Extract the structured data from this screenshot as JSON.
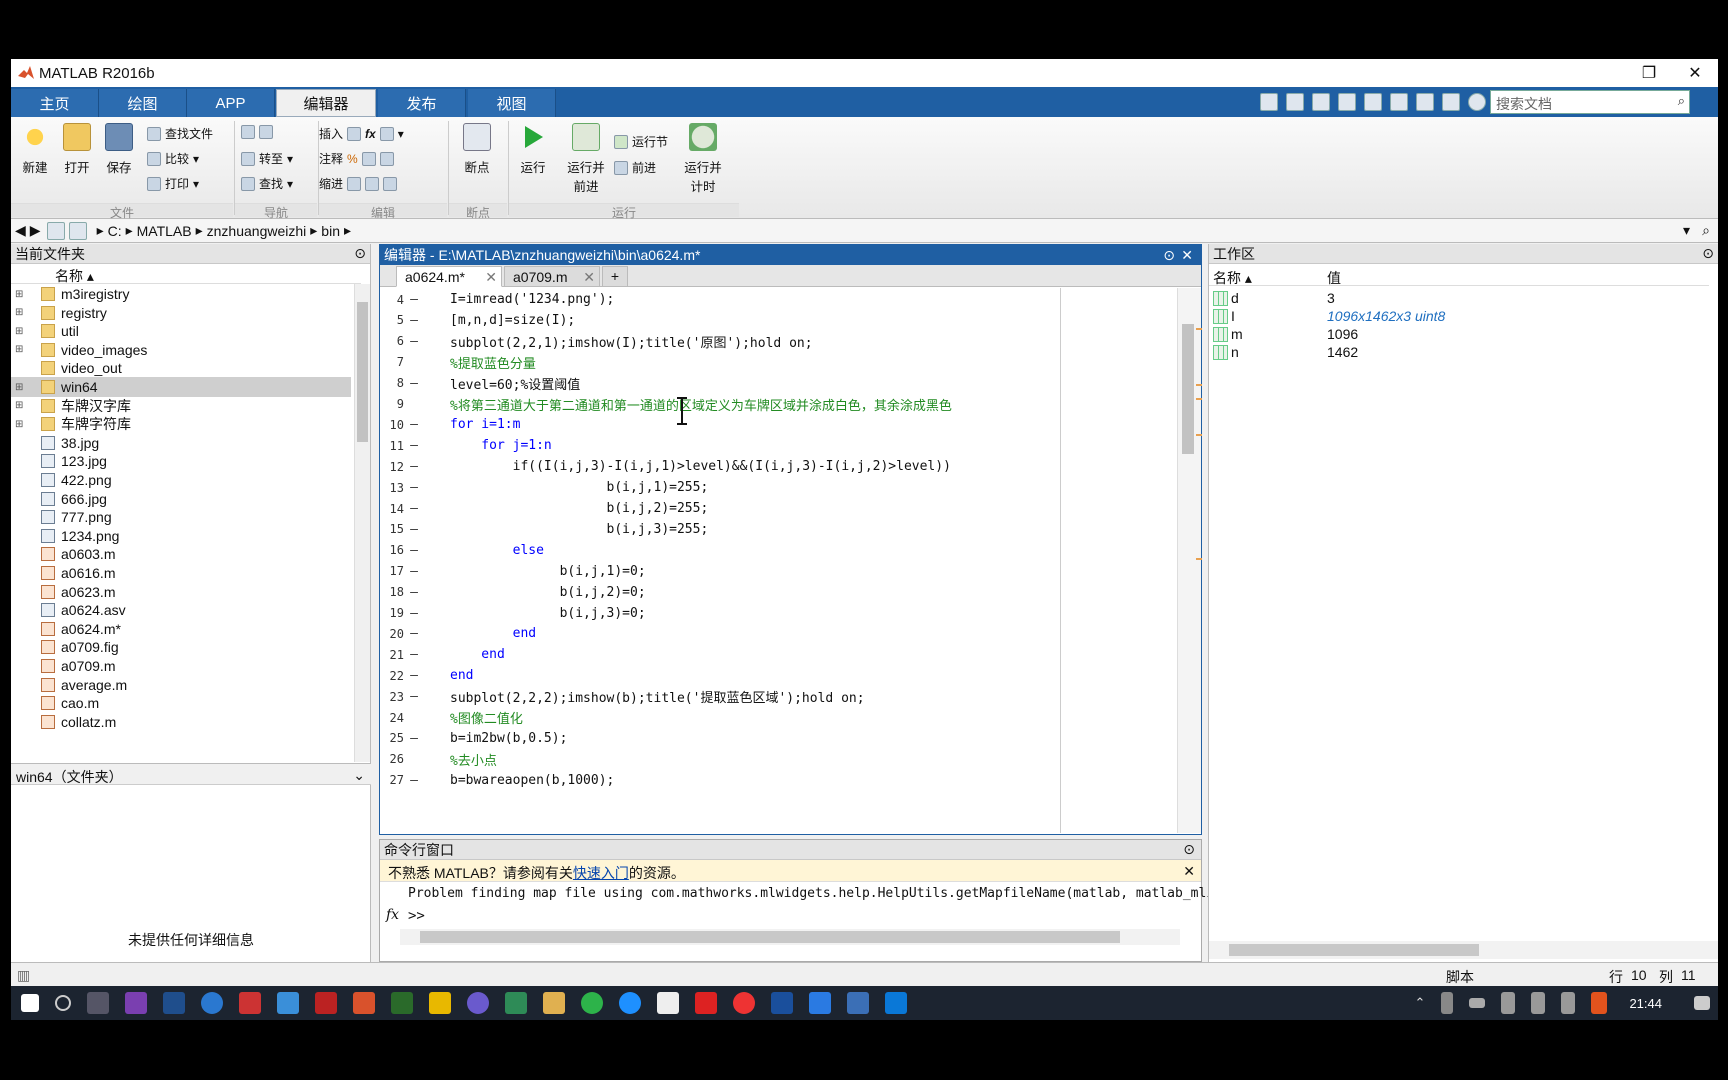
{
  "app": {
    "title": "MATLAB R2016b",
    "restore": "❐",
    "close": "✕"
  },
  "ribbon_tabs": [
    "主页",
    "绘图",
    "APP",
    "编辑器",
    "发布",
    "视图"
  ],
  "search": {
    "placeholder": "搜索文档"
  },
  "ribbon": {
    "file": {
      "new": "新建",
      "open": "打开",
      "save": "保存",
      "find_files": "查找文件",
      "compare": "比较",
      "print": "打印",
      "label": "文件"
    },
    "nav": {
      "goto": "转至",
      "find": "查找",
      "label": "导航"
    },
    "edit": {
      "insert": "插入",
      "comment": "注释",
      "indent": "缩进",
      "fx": "fx",
      "label": "编辑"
    },
    "breakpoints": {
      "btn": "断点",
      "label": "断点"
    },
    "run": {
      "run": "运行",
      "run_advance": "运行并\n前进",
      "run_section": "运行节",
      "advance": "前进",
      "run_time": "运行并\n计时",
      "label": "运行"
    }
  },
  "address": {
    "crumbs": [
      "C:",
      "MATLAB",
      "znzhuangweizhi",
      "bin"
    ]
  },
  "filepanel": {
    "title": "当前文件夹",
    "col_name": "名称 ▴",
    "items": [
      {
        "name": "m3iregistry",
        "type": "folder",
        "exp": "⊞"
      },
      {
        "name": "registry",
        "type": "folder",
        "exp": "⊞"
      },
      {
        "name": "util",
        "type": "folder",
        "exp": "⊞"
      },
      {
        "name": "video_images",
        "type": "folder",
        "exp": "⊞"
      },
      {
        "name": "video_out",
        "type": "folder",
        "exp": ""
      },
      {
        "name": "win64",
        "type": "folder",
        "exp": "⊞"
      },
      {
        "name": "车牌汉字库",
        "type": "folder",
        "exp": "⊞"
      },
      {
        "name": "车牌字符库",
        "type": "folder",
        "exp": "⊞"
      },
      {
        "name": "38.jpg",
        "type": "img",
        "exp": ""
      },
      {
        "name": "123.jpg",
        "type": "img",
        "exp": ""
      },
      {
        "name": "422.png",
        "type": "img",
        "exp": ""
      },
      {
        "name": "666.jpg",
        "type": "img",
        "exp": ""
      },
      {
        "name": "777.png",
        "type": "img",
        "exp": ""
      },
      {
        "name": "1234.png",
        "type": "img",
        "exp": ""
      },
      {
        "name": "a0603.m",
        "type": "m",
        "exp": ""
      },
      {
        "name": "a0616.m",
        "type": "m",
        "exp": ""
      },
      {
        "name": "a0623.m",
        "type": "m",
        "exp": ""
      },
      {
        "name": "a0624.asv",
        "type": "img",
        "exp": ""
      },
      {
        "name": "a0624.m*",
        "type": "m",
        "exp": ""
      },
      {
        "name": "a0709.fig",
        "type": "m",
        "exp": ""
      },
      {
        "name": "a0709.m",
        "type": "m",
        "exp": ""
      },
      {
        "name": "average.m",
        "type": "m",
        "exp": ""
      },
      {
        "name": "cao.m",
        "type": "m",
        "exp": ""
      },
      {
        "name": "collatz.m",
        "type": "m",
        "exp": ""
      }
    ],
    "detail_title": "win64（文件夹）",
    "no_detail": "未提供任何详细信息"
  },
  "editor": {
    "title": "编辑器 - E:\\MATLAB\\znzhuangweizhi\\bin\\a0624.m*",
    "tabs": [
      "a0624.m*",
      "a0709.m"
    ],
    "add_tab": "+",
    "lines": [
      {
        "n": "4",
        "d": "—",
        "t": "I=imread('1234.png');"
      },
      {
        "n": "5",
        "d": "—",
        "t": "[m,n,d]=size(I);"
      },
      {
        "n": "6",
        "d": "—",
        "t": "subplot(2,2,1);imshow(I);title('原图');hold on;"
      },
      {
        "n": "7",
        "d": "",
        "t": "%提取蓝色分量"
      },
      {
        "n": "8",
        "d": "—",
        "t": "level=60;%设置阈值"
      },
      {
        "n": "9",
        "d": "",
        "t": "%将第三通道大于第二通道和第一通道的区域定义为车牌区域并涂成白色，其余涂成黑色"
      },
      {
        "n": "10",
        "d": "—",
        "t": "for i=1:m"
      },
      {
        "n": "11",
        "d": "—",
        "t": "    for j=1:n"
      },
      {
        "n": "12",
        "d": "—",
        "t": "        if((I(i,j,3)-I(i,j,1)>level)&&(I(i,j,3)-I(i,j,2)>level))"
      },
      {
        "n": "13",
        "d": "—",
        "t": "                    b(i,j,1)=255;"
      },
      {
        "n": "14",
        "d": "—",
        "t": "                    b(i,j,2)=255;"
      },
      {
        "n": "15",
        "d": "—",
        "t": "                    b(i,j,3)=255;"
      },
      {
        "n": "16",
        "d": "—",
        "t": "        else"
      },
      {
        "n": "17",
        "d": "—",
        "t": "              b(i,j,1)=0;"
      },
      {
        "n": "18",
        "d": "—",
        "t": "              b(i,j,2)=0;"
      },
      {
        "n": "19",
        "d": "—",
        "t": "              b(i,j,3)=0;"
      },
      {
        "n": "20",
        "d": "—",
        "t": "        end"
      },
      {
        "n": "21",
        "d": "—",
        "t": "    end"
      },
      {
        "n": "22",
        "d": "—",
        "t": "end"
      },
      {
        "n": "23",
        "d": "—",
        "t": "subplot(2,2,2);imshow(b);title('提取蓝色区域');hold on;"
      },
      {
        "n": "24",
        "d": "",
        "t": "%图像二值化"
      },
      {
        "n": "25",
        "d": "—",
        "t": "b=im2bw(b,0.5);"
      },
      {
        "n": "26",
        "d": "",
        "t": "%去小点"
      },
      {
        "n": "27",
        "d": "—",
        "t": "b=bwareaopen(b,1000);"
      }
    ]
  },
  "cmd": {
    "title": "命令行窗口",
    "banner_pre": "不熟悉 MATLAB？请参阅有关",
    "banner_link": "快速入门",
    "banner_post": "的资源。",
    "output": "Problem finding map file using com.mathworks.mlwidgets.help.HelpUtils.getMapfileName(matlab, matlab_mlint_cs",
    "fx": "fx",
    "prompt": ">>"
  },
  "workspace": {
    "title": "工作区",
    "col_name": "名称 ▴",
    "col_value": "值",
    "vars": [
      {
        "name": "d",
        "value": "3"
      },
      {
        "name": "I",
        "value": "1096x1462x3 uint8"
      },
      {
        "name": "m",
        "value": "1096"
      },
      {
        "name": "n",
        "value": "1462"
      }
    ]
  },
  "status": {
    "mode": "脚本",
    "row_label": "行",
    "row": "10",
    "col_label": "列",
    "col": "11"
  },
  "taskbar": {
    "time": "21:44"
  }
}
